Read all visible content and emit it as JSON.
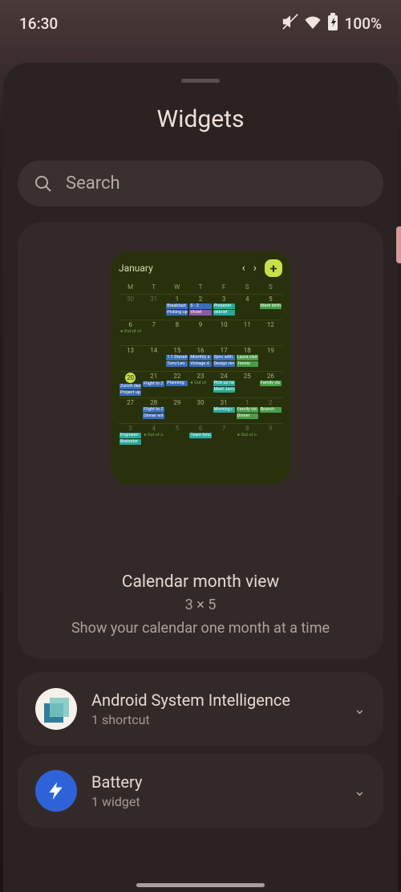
{
  "status": {
    "time": "16:30",
    "battery": "100%"
  },
  "sheet": {
    "title": "Widgets",
    "search_placeholder": "Search"
  },
  "preview": {
    "title": "Calendar month view",
    "dim": "3 × 5",
    "desc": "Show your calendar one month at a time",
    "cal": {
      "month": "January",
      "dow": [
        "M",
        "T",
        "W",
        "T",
        "F",
        "S",
        "S"
      ],
      "weeks": [
        [
          {
            "n": "30",
            "dim": true
          },
          {
            "n": "31",
            "dim": true
          },
          {
            "n": "1",
            "ev": [
              {
                "t": "Breakfast",
                "c": "b"
              },
              {
                "t": "Picking up",
                "c": "b"
              }
            ]
          },
          {
            "n": "2",
            "ev": [
              {
                "t": "5 - 2",
                "c": "b"
              },
              {
                "t": "Violet",
                "c": "p"
              }
            ]
          },
          {
            "n": "3",
            "ev": [
              {
                "t": "Presentn",
                "c": "t"
              },
              {
                "t": "debrief",
                "c": "t"
              }
            ]
          },
          {
            "n": "4"
          },
          {
            "n": "5",
            "ev": [
              {
                "t": "Mark birth",
                "c": "g"
              }
            ]
          }
        ],
        [
          {
            "n": "6",
            "ev": [
              {
                "t": "● Out of office",
                "c": "o"
              }
            ]
          },
          {
            "n": "7"
          },
          {
            "n": "8"
          },
          {
            "n": "9"
          },
          {
            "n": "10"
          },
          {
            "n": "11"
          },
          {
            "n": "12"
          }
        ],
        [
          {
            "n": "13"
          },
          {
            "n": "14"
          },
          {
            "n": "15",
            "ev": [
              {
                "t": "1:1 Steven",
                "c": "b"
              },
              {
                "t": "Tom/Leo",
                "c": "b"
              }
            ]
          },
          {
            "n": "16",
            "ev": [
              {
                "t": "Monthly a",
                "c": "b"
              },
              {
                "t": "Vintage d",
                "c": "b"
              }
            ]
          },
          {
            "n": "17",
            "ev": [
              {
                "t": "Sync with",
                "c": "b"
              },
              {
                "t": "Design rev",
                "c": "b"
              }
            ]
          },
          {
            "n": "18",
            "ev": [
              {
                "t": "Laura visit",
                "c": "g"
              },
              {
                "t": "Tennis",
                "c": "g"
              }
            ]
          },
          {
            "n": "19"
          }
        ],
        [
          {
            "n": "20",
            "today": true,
            "ev": [
              {
                "t": "Zurich design days",
                "c": "b"
              },
              {
                "t": "Project up",
                "c": "b"
              }
            ]
          },
          {
            "n": "21",
            "ev": [
              {
                "t": "",
                "c": "b"
              },
              {
                "t": "Flight to Z",
                "c": "b"
              }
            ]
          },
          {
            "n": "22",
            "ev": [
              {
                "t": "Planning",
                "c": "b"
              },
              {
                "t": "",
                "c": "b"
              }
            ]
          },
          {
            "n": "23",
            "ev": [
              {
                "t": "● Out of",
                "c": "o"
              },
              {
                "t": "",
                "c": "b"
              }
            ]
          },
          {
            "n": "24",
            "ev": [
              {
                "t": "Pick up ne",
                "c": "t"
              },
              {
                "t": "Meet Jami",
                "c": "t"
              }
            ]
          },
          {
            "n": "25"
          },
          {
            "n": "26",
            "ev": [
              {
                "t": "Family vis",
                "c": "g"
              }
            ]
          }
        ],
        [
          {
            "n": "27"
          },
          {
            "n": "28",
            "ev": [
              {
                "t": "Flight to Z",
                "c": "b"
              },
              {
                "t": "Dinner wit",
                "c": "b"
              }
            ]
          },
          {
            "n": "29"
          },
          {
            "n": "30"
          },
          {
            "n": "31",
            "ev": [
              {
                "t": "Morning r",
                "c": "t"
              }
            ]
          },
          {
            "n": "1",
            "dim": true,
            "ev": [
              {
                "t": "Family vis",
                "c": "g"
              },
              {
                "t": "Dinner",
                "c": "g"
              }
            ]
          },
          {
            "n": "2",
            "dim": true,
            "ev": [
              {
                "t": "Brunch",
                "c": "g"
              }
            ]
          }
        ],
        [
          {
            "n": "3",
            "dim": true,
            "ev": [
              {
                "t": "Engineeri",
                "c": "t"
              },
              {
                "t": "Brainstor",
                "c": "t"
              }
            ]
          },
          {
            "n": "4",
            "dim": true,
            "ev": [
              {
                "t": "● Out of o",
                "c": "o"
              }
            ]
          },
          {
            "n": "5",
            "dim": true
          },
          {
            "n": "6",
            "dim": true,
            "ev": [
              {
                "t": "Team lunc",
                "c": "t"
              }
            ]
          },
          {
            "n": "7",
            "dim": true
          },
          {
            "n": "8",
            "dim": true,
            "ev": [
              {
                "t": "● Out of o",
                "c": "o"
              }
            ]
          },
          {
            "n": "9",
            "dim": true
          }
        ]
      ]
    }
  },
  "rows": [
    {
      "title": "Android System Intelligence",
      "sub": "1 shortcut",
      "icon": "asi"
    },
    {
      "title": "Battery",
      "sub": "1 widget",
      "icon": "bat"
    }
  ]
}
